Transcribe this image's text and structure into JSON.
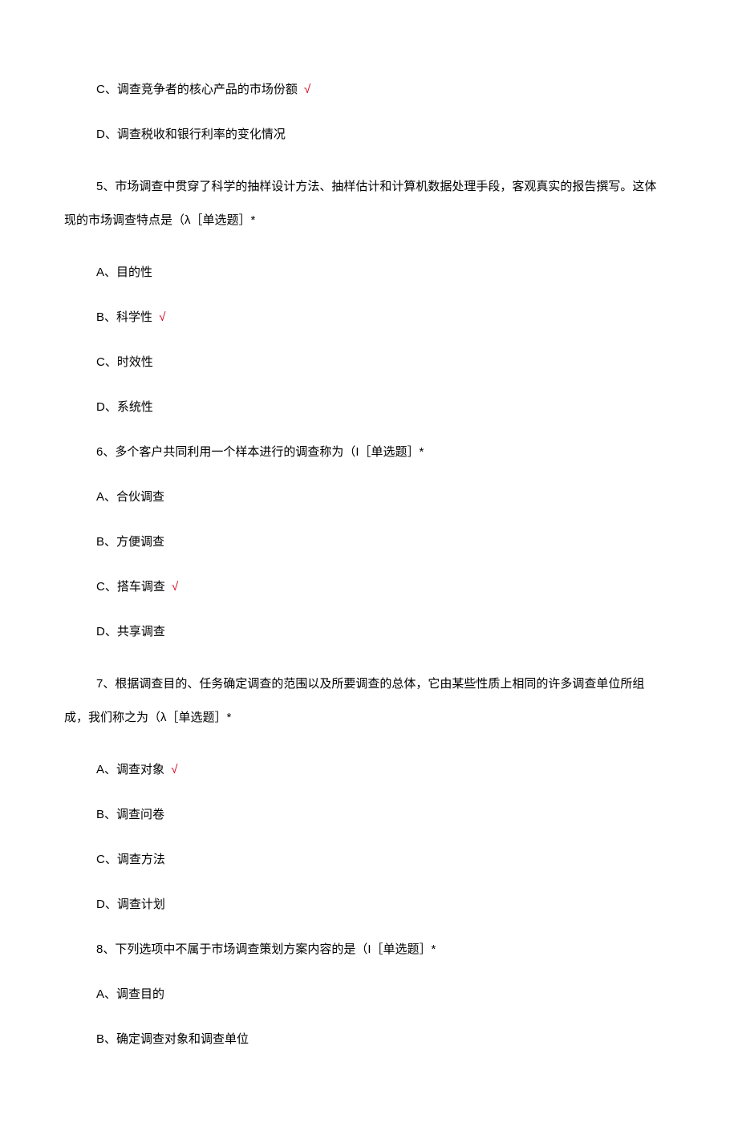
{
  "check_symbol": "√",
  "q4_remainder": {
    "option_c": "C、调查竞争者的核心产品的市场份额",
    "option_c_correct": true,
    "option_d": "D、调查税收和银行利率的变化情况"
  },
  "q5": {
    "text_line1": "5、市场调查中贯穿了科学的抽样设计方法、抽样估计和计算机数据处理手段，客观真实的报告撰写。这体",
    "text_line2": "现的市场调查特点是（λ［单选题］*",
    "option_a": "A、目的性",
    "option_b": "B、科学性",
    "option_b_correct": true,
    "option_c": "C、时效性",
    "option_d": "D、系统性"
  },
  "q6": {
    "text": "6、多个客户共同利用一个样本进行的调查称为（I［单选题］*",
    "option_a": "A、合伙调查",
    "option_b": "B、方便调查",
    "option_c": "C、搭车调查",
    "option_c_correct": true,
    "option_d": "D、共享调查"
  },
  "q7": {
    "text_line1": "7、根据调查目的、任务确定调查的范围以及所要调查的总体，它由某些性质上相同的许多调查单位所组",
    "text_line2": "成，我们称之为（λ［单选题］*",
    "option_a": "A、调查对象",
    "option_a_correct": true,
    "option_b": "B、调查问卷",
    "option_c": "C、调查方法",
    "option_d": "D、调查计划"
  },
  "q8": {
    "text": "8、下列选项中不属于市场调查策划方案内容的是（I［单选题］*",
    "option_a": "A、调查目的",
    "option_b": "B、确定调查对象和调查单位"
  }
}
